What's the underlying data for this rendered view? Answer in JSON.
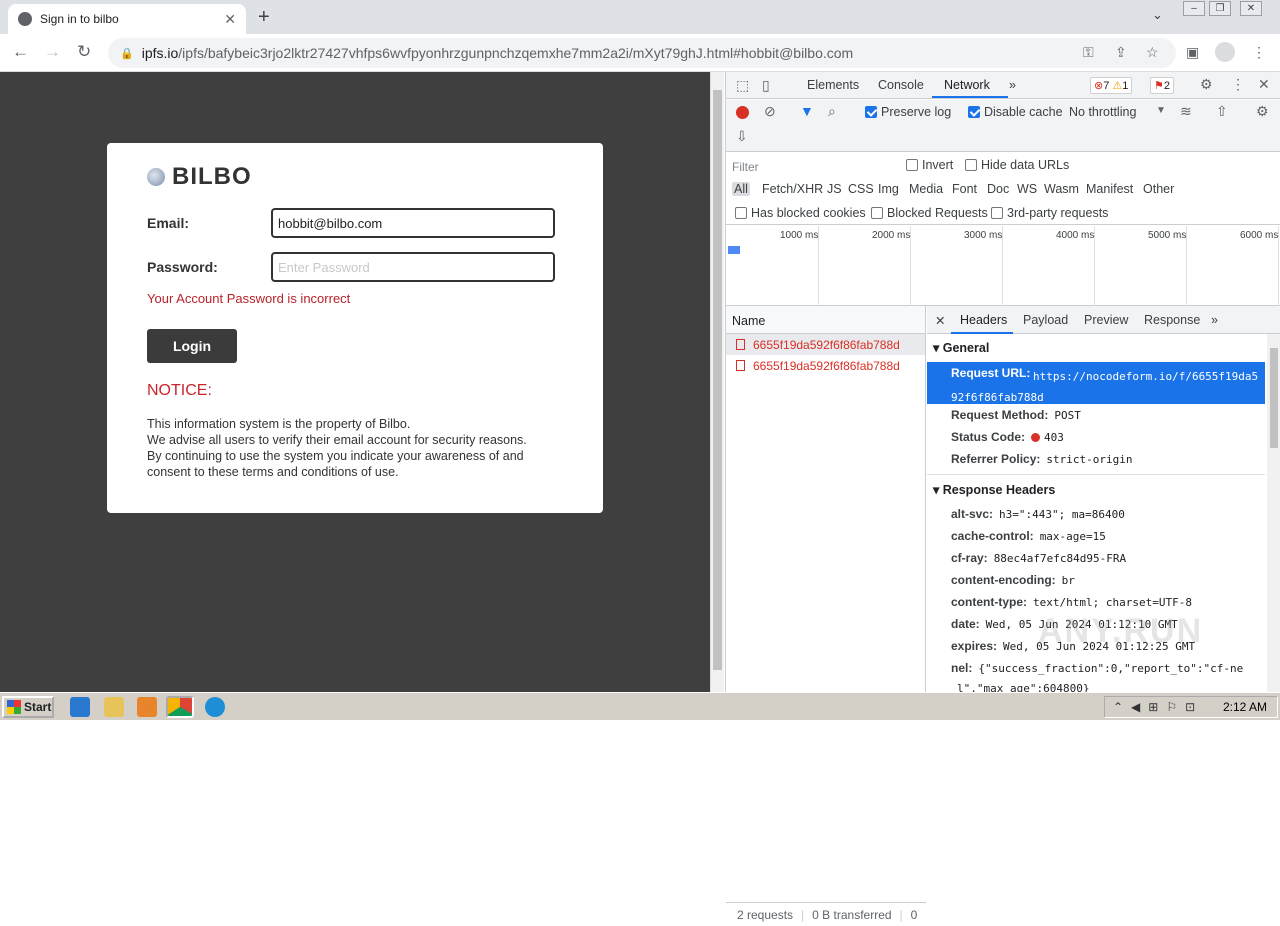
{
  "browser": {
    "tab_title": "Sign in to bilbo",
    "tab_close": "✕",
    "new_tab": "+",
    "url_host": "ipfs.io",
    "url_path": "/ipfs/bafybeic3rjo2lktr27427vhfps6wvfpyonhrzgunpnchzqemxhe7mm2a2i/mXyt79ghJ.html#hobbit@bilbo.com"
  },
  "page": {
    "logo_text": "BILBO",
    "email_label": "Email:",
    "email_value": "hobbit@bilbo.com",
    "password_label": "Password:",
    "password_placeholder": "Enter Password",
    "error_message": "Your Account Password is incorrect",
    "login_button": "Login",
    "notice_title": "NOTICE:",
    "notice_lines": [
      "This information system is the property of Bilbo.",
      "We advise all users to verify their email account for security reasons.",
      "By continuing to use the system you indicate your awareness of and",
      "consent to these terms and conditions of use."
    ]
  },
  "devtools": {
    "tabs": [
      "Elements",
      "Console",
      "Network"
    ],
    "more": "»",
    "errors_badge": "7",
    "warnings_badge": "1",
    "issues_badge": "2",
    "preserve_log": "Preserve log",
    "disable_cache": "Disable cache",
    "throttling": "No throttling",
    "filter_placeholder": "Filter",
    "invert": "Invert",
    "hide_data_urls": "Hide data URLs",
    "filter_types": [
      "All",
      "Fetch/XHR",
      "JS",
      "CSS",
      "Img",
      "Media",
      "Font",
      "Doc",
      "WS",
      "Wasm",
      "Manifest",
      "Other"
    ],
    "has_blocked_cookies": "Has blocked cookies",
    "blocked_requests": "Blocked Requests",
    "third_party": "3rd-party requests",
    "timeline_ticks": [
      "1000 ms",
      "2000 ms",
      "3000 ms",
      "4000 ms",
      "5000 ms",
      "6000 ms"
    ],
    "name_header": "Name",
    "requests": [
      "6655f19da592f6f86fab788d",
      "6655f19da592f6f86fab788d"
    ],
    "status_requests": "2 requests",
    "status_transferred": "0 B transferred",
    "status_zero": "0",
    "detail_tabs": [
      "Headers",
      "Payload",
      "Preview",
      "Response"
    ],
    "general_title": "General",
    "request_url_key": "Request URL:",
    "request_url_value": "https://nocodeform.io/f/6655f19da592f6f86fab788d",
    "request_method_key": "Request Method:",
    "request_method_value": "POST",
    "status_code_key": "Status Code:",
    "status_code_value": "403",
    "referrer_policy_key": "Referrer Policy:",
    "referrer_policy_value": "strict-origin",
    "response_headers_title": "Response Headers",
    "response_headers": [
      {
        "k": "alt-svc:",
        "v": "h3=\":443\"; ma=86400"
      },
      {
        "k": "cache-control:",
        "v": "max-age=15"
      },
      {
        "k": "cf-ray:",
        "v": "88ec4af7efc84d95-FRA"
      },
      {
        "k": "content-encoding:",
        "v": "br"
      },
      {
        "k": "content-type:",
        "v": "text/html; charset=UTF-8"
      },
      {
        "k": "date:",
        "v": "Wed, 05 Jun 2024 01:12:10 GMT"
      },
      {
        "k": "expires:",
        "v": "Wed, 05 Jun 2024 01:12:25 GMT"
      },
      {
        "k": "nel:",
        "v": "{\"success_fraction\":0,\"report_to\":\"cf-ne"
      },
      {
        "k": "",
        "v": "l\",\"max_age\":604800}"
      }
    ],
    "watermark": "ANY.RUN"
  },
  "taskbar": {
    "start": "Start",
    "clock": "2:12 AM"
  }
}
